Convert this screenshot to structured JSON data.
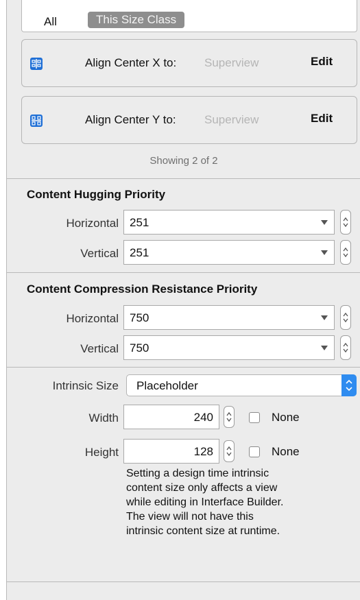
{
  "size_class_bar": {
    "all_label": "All",
    "active_label": "This Size Class"
  },
  "constraints": [
    {
      "icon": "align-center-x-icon",
      "label": "Align Center X to:",
      "target": "Superview",
      "edit_label": "Edit"
    },
    {
      "icon": "align-center-y-icon",
      "label": "Align Center Y to:",
      "target": "Superview",
      "edit_label": "Edit"
    }
  ],
  "showing_text": "Showing 2 of 2",
  "content_hugging": {
    "title": "Content Hugging Priority",
    "horizontal_label": "Horizontal",
    "horizontal_value": "251",
    "vertical_label": "Vertical",
    "vertical_value": "251"
  },
  "compression_resistance": {
    "title": "Content Compression Resistance Priority",
    "horizontal_label": "Horizontal",
    "horizontal_value": "750",
    "vertical_label": "Vertical",
    "vertical_value": "750"
  },
  "intrinsic_size": {
    "label": "Intrinsic Size",
    "value": "Placeholder",
    "width_label": "Width",
    "width_value": "240",
    "width_none_label": "None",
    "height_label": "Height",
    "height_value": "128",
    "height_none_label": "None",
    "note_lines": [
      "Setting a design time intrinsic",
      "content size only affects a view",
      "while editing in Interface Builder.",
      "The view will not have this",
      "intrinsic content size at runtime."
    ]
  },
  "colors": {
    "panel_bg": "#ececec",
    "accent": "#2f8cf0",
    "constraint_icon": "#1f6fd6",
    "segment_active_bg": "#8e8e8e",
    "placeholder_text": "#b5b5b5"
  }
}
